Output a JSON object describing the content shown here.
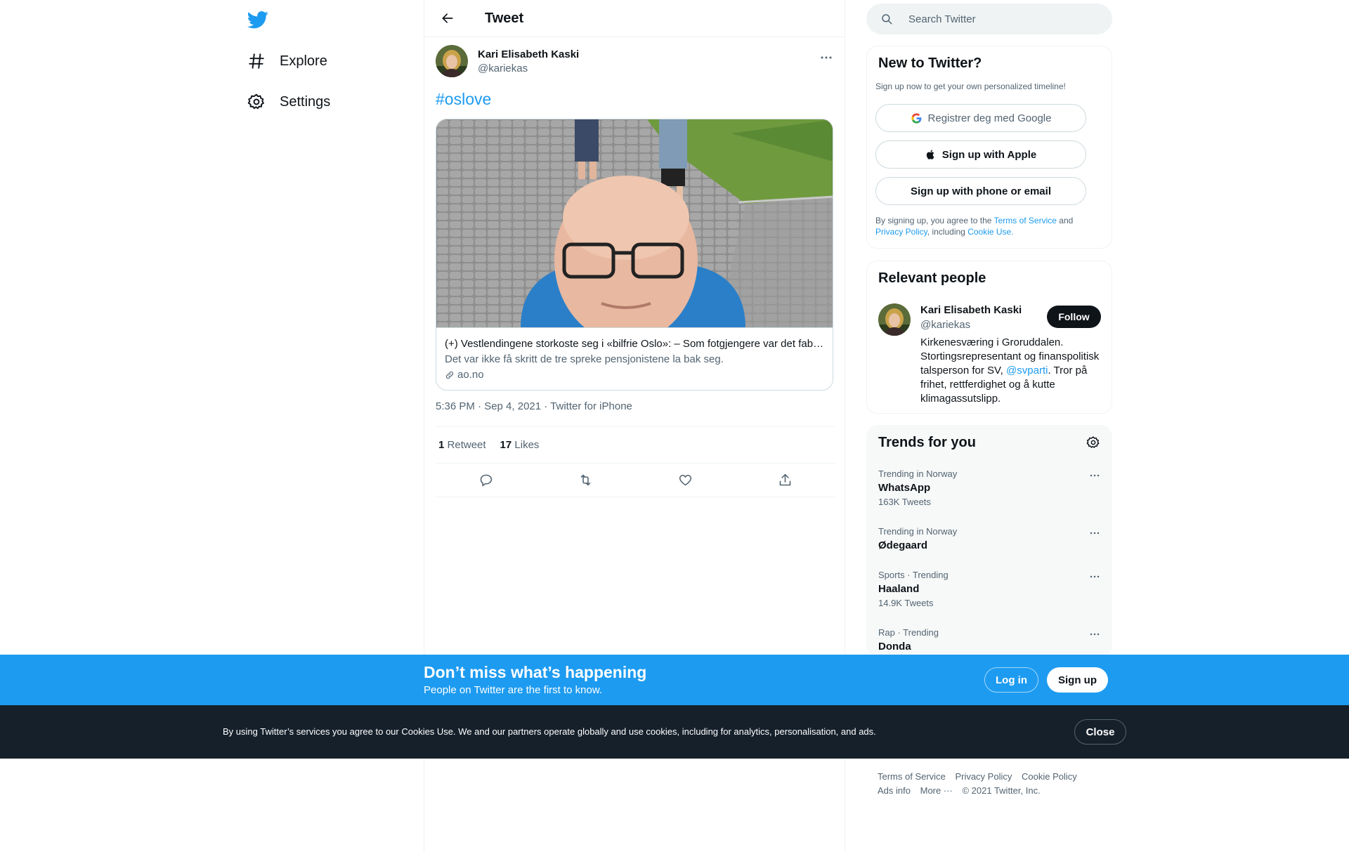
{
  "nav": {
    "explore": "Explore",
    "settings": "Settings"
  },
  "header": {
    "title": "Tweet"
  },
  "tweet": {
    "author_name": "Kari Elisabeth Kaski",
    "author_handle": "@kariekas",
    "text": "#oslove",
    "card": {
      "title": "(+) Vestlendingene storkoste seg i «bilfrie Oslo»: – Som fotgjengere var det fabelaktig",
      "description": "Det var ikke få skritt de tre spreke pensjonistene la bak seg.",
      "domain": "ao.no"
    },
    "timestamp": "5:36 PM · Sep 4, 2021 · Twitter for iPhone",
    "retweets_count": "1",
    "retweets_label": "Retweet",
    "likes_count": "17",
    "likes_label": "Likes"
  },
  "search": {
    "placeholder": "Search Twitter"
  },
  "new_to_twitter": {
    "title": "New to Twitter?",
    "subtitle": "Sign up now to get your own personalized timeline!",
    "google_button": "Registrer deg med Google",
    "apple_button": "Sign up with Apple",
    "phone_button": "Sign up with phone or email",
    "terms_prefix": "By signing up, you agree to the",
    "terms_link": "Terms of Service",
    "terms_and": "and",
    "privacy_link": "Privacy Policy",
    "including": ", including",
    "cookie_link": "Cookie Use."
  },
  "relevant_people": {
    "title": "Relevant people",
    "name": "Kari Elisabeth Kaski",
    "handle": "@kariekas",
    "follow_button": "Follow",
    "bio_part1": "Kirkenesværing i Groruddalen. Stortingsrepresentant og finanspolitisk talsperson for SV,",
    "bio_mention": "@svparti",
    "bio_part2": ". Tror på frihet, rettferdighet og å kutte klimagassutslipp."
  },
  "trends": {
    "title": "Trends for you",
    "items": [
      {
        "context": "Trending in Norway",
        "name": "WhatsApp",
        "count": "163K Tweets"
      },
      {
        "context": "Trending in Norway",
        "name": "Ødegaard",
        "count": ""
      },
      {
        "context": "Sports · Trending",
        "name": "Haaland",
        "count": "14.9K Tweets"
      },
      {
        "context": "Rap · Trending",
        "name": "Donda",
        "count": ""
      }
    ]
  },
  "footer": {
    "terms": "Terms of Service",
    "privacy": "Privacy Policy",
    "cookie": "Cookie Policy",
    "ads": "Ads info",
    "more": "More ···",
    "copyright": "© 2021 Twitter, Inc."
  },
  "signup_bar": {
    "title": "Don’t miss what’s happening",
    "subtitle": "People on Twitter are the first to know.",
    "login": "Log in",
    "signup": "Sign up"
  },
  "cookie_bar": {
    "text": "By using Twitter’s services you agree to our Cookies Use. We and our partners operate globally and use cookies, including for analytics, personalisation, and ads.",
    "close": "Close"
  },
  "colors": {
    "accent": "#1d9bf0",
    "text": "#0f1419",
    "secondary": "#536471",
    "border": "#eff3f4",
    "cookie_bg": "#15202b"
  }
}
